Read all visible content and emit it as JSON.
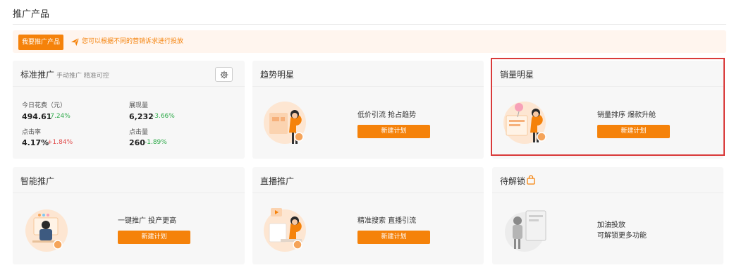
{
  "page": {
    "title": "推广产品"
  },
  "notice": {
    "button_label": "我要推广产品",
    "text": "您可以根据不同的营销诉求进行投放"
  },
  "cards": {
    "standard": {
      "title": "标准推广",
      "subtitle": "手动推广 精准可控",
      "stats": [
        {
          "label": "今日花费（元）",
          "value": "494.61",
          "change": "-7.24%"
        },
        {
          "label": "展现量",
          "value": "6,232",
          "change": "-3.66%"
        },
        {
          "label": "点击率",
          "value": "4.17%",
          "change": "+1.84%"
        },
        {
          "label": "点击量",
          "value": "260",
          "change": "-1.89%"
        }
      ]
    },
    "trend": {
      "title": "趋势明星",
      "desc": "低价引流 抢占趋势",
      "button": "新建计划"
    },
    "sales": {
      "title": "销量明星",
      "desc": "销量排序 爆款升舱",
      "button": "新建计划"
    },
    "smart": {
      "title": "智能推广",
      "desc": "一键推广 投产更高",
      "button": "新建计划"
    },
    "live": {
      "title": "直播推广",
      "desc": "精准搜索 直播引流",
      "button": "新建计划"
    },
    "locked": {
      "title": "待解锁",
      "desc_line1": "加油投放",
      "desc_line2": "可解锁更多功能"
    }
  },
  "colors": {
    "accent": "#f5820a",
    "down": "#2eaa4a",
    "up": "#e04a4a",
    "highlight": "#d93a3a"
  }
}
